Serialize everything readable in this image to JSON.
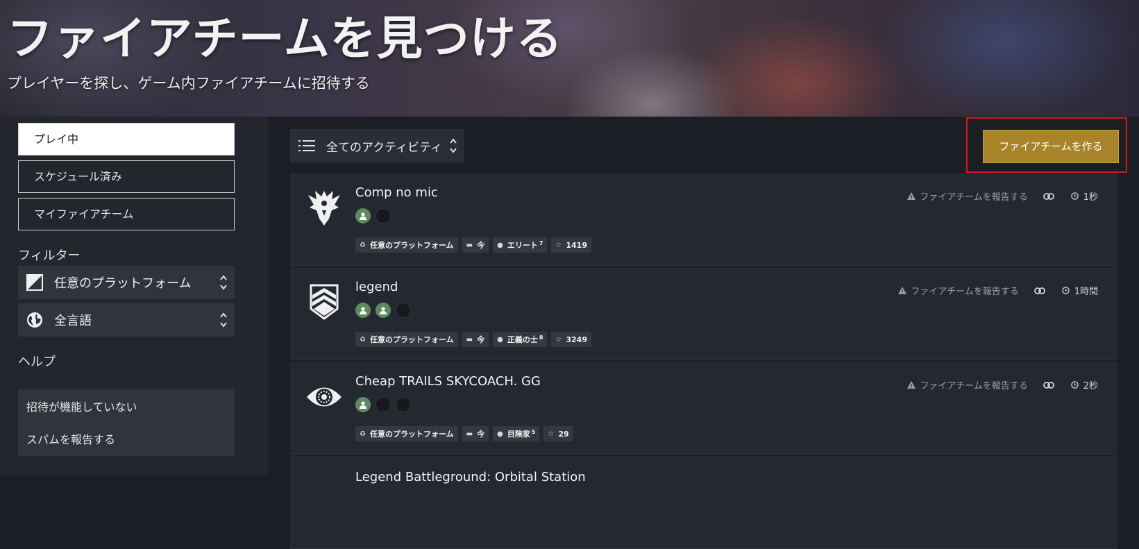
{
  "hero": {
    "title": "ファイアチームを見つける",
    "subtitle": "プレイヤーを探し、ゲーム内ファイアチームに招待する"
  },
  "sidebar": {
    "tabs": [
      {
        "label": "プレイ中",
        "active": true
      },
      {
        "label": "スケジュール済み",
        "active": false
      },
      {
        "label": "マイファイアチーム",
        "active": false
      }
    ],
    "filters_heading": "フィルター",
    "platform_select": "任意のプラットフォーム",
    "language_select": "全言語",
    "help_heading": "ヘルプ",
    "help_links": [
      "招待が機能していない",
      "スパムを報告する"
    ]
  },
  "toolbar": {
    "activity_select": "全てのアクティビティ",
    "create_button": "ファイアチームを作る"
  },
  "fireteams": [
    {
      "name": "Comp no mic",
      "emblem": "warlord-eagle-icon",
      "slots": [
        "filled",
        "empty"
      ],
      "platform": "任意のプラットフォーム",
      "when": "今",
      "rank": "エリート",
      "rank_sup": "7",
      "score": "1419",
      "report": "ファイアチームを報告する",
      "time": "1秒"
    },
    {
      "name": "legend",
      "emblem": "chevron-shield-icon",
      "slots": [
        "filled",
        "filled",
        "empty"
      ],
      "platform": "任意のプラットフォーム",
      "when": "今",
      "rank": "正義の士",
      "rank_sup": "8",
      "score": "3249",
      "report": "ファイアチームを報告する",
      "time": "1時間"
    },
    {
      "name": "Cheap TRAILS SKYCOACH. GG",
      "emblem": "eye-of-savathun-icon",
      "slots": [
        "filled",
        "empty",
        "empty"
      ],
      "platform": "任意のプラットフォーム",
      "when": "今",
      "rank": "目険家",
      "rank_sup": "5",
      "score": "29",
      "report": "ファイアチームを報告する",
      "time": "2秒"
    },
    {
      "name": "Legend Battleground: Orbital Station"
    }
  ],
  "colors": {
    "accent_gold": "#a7842a",
    "highlight_red": "#d0191c",
    "member_green": "#5f8a5f"
  }
}
